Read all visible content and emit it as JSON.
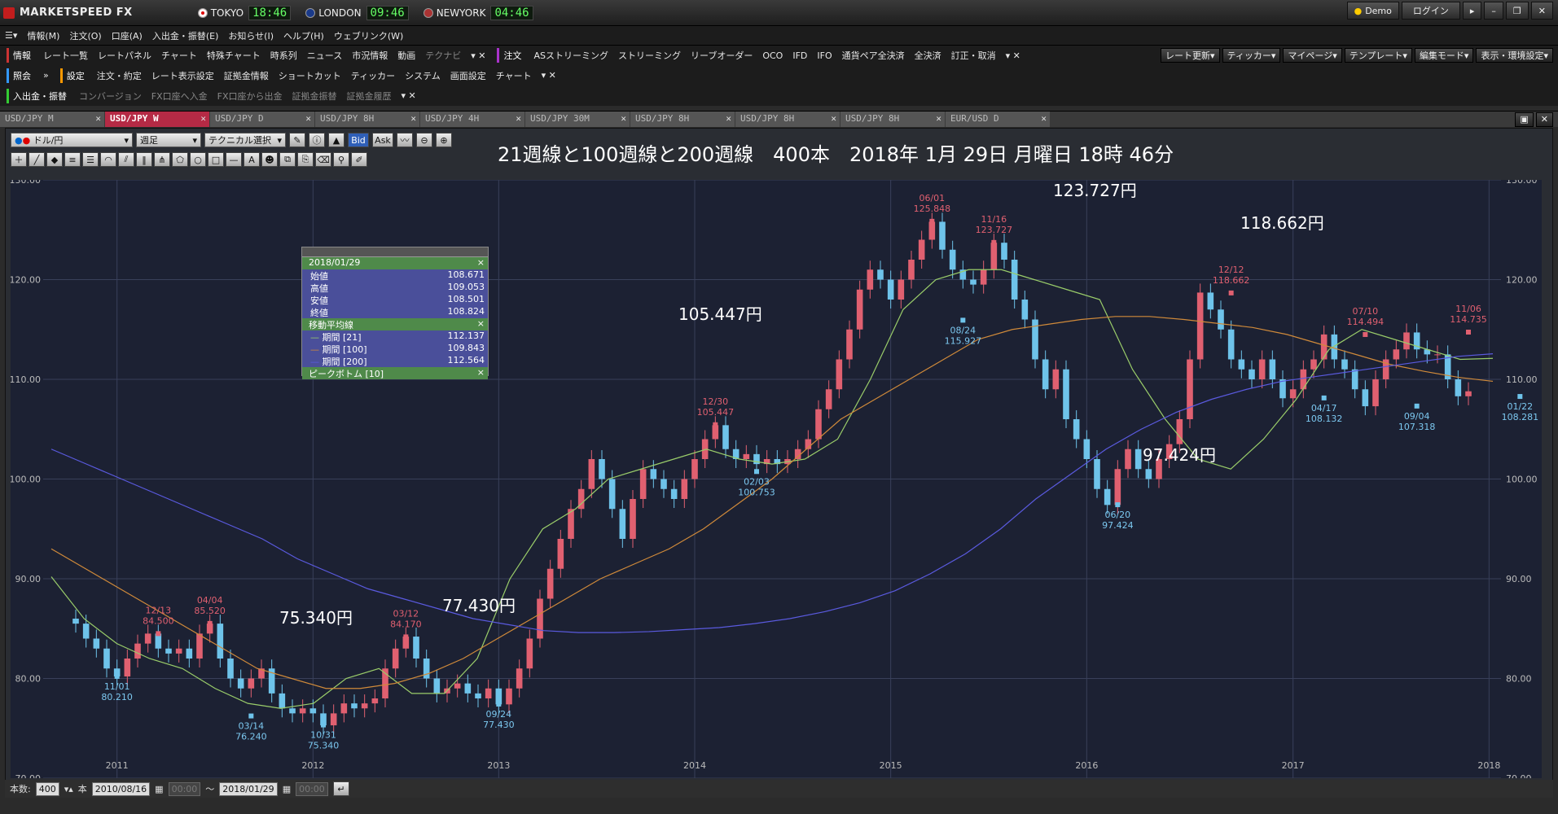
{
  "app": {
    "logo": "MARKETSPEED FX",
    "clocks": [
      {
        "city": "TOKYO",
        "time": "18:46"
      },
      {
        "city": "LONDON",
        "time": "09:46"
      },
      {
        "city": "NEWYORK",
        "time": "04:46"
      }
    ],
    "demo": "Demo",
    "login": "ログイン"
  },
  "menu": [
    "情報(M)",
    "注文(O)",
    "口座(A)",
    "入出金・振替(E)",
    "お知らせ(I)",
    "ヘルプ(H)",
    "ウェブリンク(W)"
  ],
  "row2": {
    "tag": "情報",
    "items": [
      "レート一覧",
      "レートパネル",
      "チャート",
      "特殊チャート",
      "時系列",
      "ニュース",
      "市況情報",
      "動画",
      "テクナビ"
    ],
    "tag2": "注文",
    "items2": [
      "ASストリーミング",
      "ストリーミング",
      "リーブオーダー",
      "OCO",
      "IFD",
      "IFO",
      "通貨ペア全決済",
      "全決済",
      "訂正・取消"
    ],
    "right": [
      "レート更新▾",
      "ティッカー▾",
      "マイページ▾",
      "テンプレート▾",
      "編集モード▾",
      "表示・環境設定▾"
    ]
  },
  "row3": {
    "tag": "照会",
    "tag2": "設定",
    "items": [
      "注文・約定",
      "レート表示設定",
      "証拠金情報",
      "ショートカット",
      "ティッカー",
      "システム",
      "画面設定",
      "チャート"
    ]
  },
  "row4": {
    "tag": "入出金・振替",
    "items": [
      "コンバージョン",
      "FX口座へ入金",
      "FX口座から出金",
      "証拠金振替",
      "証拠金履歴"
    ]
  },
  "tabs": [
    "USD/JPY M",
    "USD/JPY W",
    "USD/JPY D",
    "USD/JPY 8H",
    "USD/JPY 4H",
    "USD/JPY 30M",
    "USD/JPY 8H",
    "USD/JPY 8H",
    "USD/JPY 8H",
    "EUR/USD D"
  ],
  "controls": {
    "pair": "ドル/円",
    "period": "週足",
    "tech": "テクニカル選択",
    "bid": "Bid",
    "ask": "Ask"
  },
  "headline": "21週線と100週線と200週線　400本　2018年 1月 29日 月曜日 18時 46分",
  "infobox": {
    "date": "2018/01/29",
    "ohlc": [
      [
        "始値",
        "108.671"
      ],
      [
        "高値",
        "109.053"
      ],
      [
        "安値",
        "108.501"
      ],
      [
        "終値",
        "108.824"
      ]
    ],
    "ma_title": "移動平均線",
    "ma": [
      [
        "期間 [21]",
        "112.137"
      ],
      [
        "期間 [100]",
        "109.843"
      ],
      [
        "期間 [200]",
        "112.564"
      ]
    ],
    "pb": "ピークボトム [10]"
  },
  "status": {
    "count_label": "本数:",
    "count": "400",
    "unit": "本",
    "from": "2010/08/16",
    "to": "2018/01/29",
    "blank": "00:00"
  },
  "chart_data": {
    "type": "candlestick",
    "ylim": [
      70,
      130
    ],
    "yticks": [
      "130.00",
      "120.00",
      "110.00",
      "100.00",
      "90.00",
      "80.00",
      "70.00"
    ],
    "years": [
      "2011",
      "2012",
      "2013",
      "2014",
      "2015",
      "2016",
      "2017",
      "2018"
    ],
    "colors": {
      "up": "#e06070",
      "down": "#6ec3ea",
      "ma21": "#9acd6a",
      "ma100": "#d08a3a",
      "ma200": "#5a5adf"
    },
    "series": [
      {
        "name": "期間 [21]",
        "values": [
          90.2,
          86,
          83.5,
          82,
          81,
          79,
          77.5,
          77,
          77.5,
          80,
          81,
          78.5,
          78.5,
          82,
          90,
          95,
          97,
          100,
          101,
          102,
          103,
          102,
          101.5,
          102,
          104,
          110,
          117,
          120,
          121,
          121,
          120,
          119,
          118,
          111,
          106,
          102,
          101,
          104,
          108,
          113,
          115,
          114,
          113,
          112,
          112.1
        ]
      },
      {
        "name": "期間 [100]",
        "values": [
          93,
          91,
          89,
          87,
          85,
          83,
          81,
          80,
          79,
          79,
          79.5,
          80.5,
          82,
          84,
          86,
          88,
          90,
          91.5,
          93,
          95,
          97.5,
          100,
          103,
          106,
          108,
          110,
          112,
          114,
          115,
          115.5,
          116,
          116.3,
          116.3,
          116,
          115.6,
          115.2,
          114.5,
          113.5,
          112.5,
          111.5,
          110.8,
          110.2,
          109.8
        ]
      },
      {
        "name": "期間 [200]",
        "values": [
          103,
          101.5,
          100,
          98.5,
          97,
          95.5,
          94,
          92,
          90.5,
          89,
          88,
          87,
          86,
          85.4,
          84.8,
          84.6,
          84.6,
          84.7,
          84.9,
          85.1,
          85.5,
          86,
          86.7,
          87.6,
          88.8,
          90.5,
          92.5,
          95,
          98,
          100.5,
          103,
          105,
          106.7,
          108,
          109,
          109.8,
          110.3,
          110.8,
          111.3,
          111.8,
          112.3,
          112.56
        ]
      }
    ],
    "close": [
      85.5,
      84,
      83,
      81,
      80.2,
      82,
      83.5,
      84.5,
      83,
      82.5,
      83,
      82,
      84.5,
      85.5,
      82,
      80,
      79,
      80,
      81,
      78.5,
      77,
      76.5,
      77,
      76.5,
      75.3,
      76.5,
      77.5,
      77,
      77.5,
      78,
      81,
      83,
      84.2,
      82,
      80,
      78.5,
      79,
      79.5,
      78.5,
      78,
      79,
      77.4,
      79,
      81,
      84,
      88,
      91,
      94,
      97,
      99,
      102,
      100,
      97,
      94,
      98,
      101,
      100,
      99,
      98,
      100,
      102,
      104,
      105.4,
      103,
      102,
      102.5,
      101.5,
      102,
      101.5,
      102,
      103,
      104,
      107,
      109,
      112,
      115,
      119,
      121,
      120,
      118,
      120,
      122,
      124,
      125.8,
      123,
      121,
      120,
      119.5,
      121,
      123.7,
      122,
      118,
      116,
      112,
      109,
      111,
      106,
      104,
      102,
      99,
      97.4,
      101,
      103,
      101,
      100,
      102,
      103.5,
      106,
      112,
      118.7,
      117,
      115,
      112,
      111,
      110,
      112,
      110,
      108.1,
      109,
      111,
      112,
      114.5,
      112,
      111,
      109,
      107.3,
      110,
      112,
      113,
      114.7,
      113,
      112.5,
      112.5,
      110,
      108.3,
      108.8
    ],
    "peaks": [
      {
        "label": "12/13\n84.500",
        "value": 84.5,
        "i": 8
      },
      {
        "label": "04/04\n85.520",
        "value": 85.52,
        "i": 13
      },
      {
        "label": "03/12\n84.170",
        "value": 84.17,
        "i": 32
      },
      {
        "label": "12/30\n105.447",
        "value": 105.447,
        "i": 62
      },
      {
        "label": "06/01\n125.848",
        "value": 125.848,
        "i": 83
      },
      {
        "label": "11/16\n123.727",
        "value": 123.727,
        "i": 89
      },
      {
        "label": "12/12\n118.662",
        "value": 118.662,
        "i": 112
      },
      {
        "label": "07/10\n114.494",
        "value": 114.494,
        "i": 125
      },
      {
        "label": "11/06\n114.735",
        "value": 114.735,
        "i": 135
      }
    ],
    "bottoms": [
      {
        "label": "11/01\n80.210",
        "value": 80.21,
        "i": 4
      },
      {
        "label": "03/14\n76.240",
        "value": 76.24,
        "i": 17
      },
      {
        "label": "10/31\n75.340",
        "value": 75.34,
        "i": 24
      },
      {
        "label": "09/24\n77.430",
        "value": 77.43,
        "i": 41
      },
      {
        "label": "02/03\n100.753",
        "value": 100.753,
        "i": 66
      },
      {
        "label": "08/24\n115.927",
        "value": 115.927,
        "i": 86
      },
      {
        "label": "06/20\n97.424",
        "value": 97.424,
        "i": 101
      },
      {
        "label": "04/17\n108.132",
        "value": 108.132,
        "i": 121
      },
      {
        "label": "09/04\n107.318",
        "value": 107.318,
        "i": 130
      },
      {
        "label": "01/22\n108.281",
        "value": 108.281,
        "i": 140
      }
    ],
    "annotations": [
      "125.848円",
      "123.727円",
      "118.662円",
      "105.447円",
      "97.424円",
      "77.430円",
      "75.340円"
    ]
  }
}
